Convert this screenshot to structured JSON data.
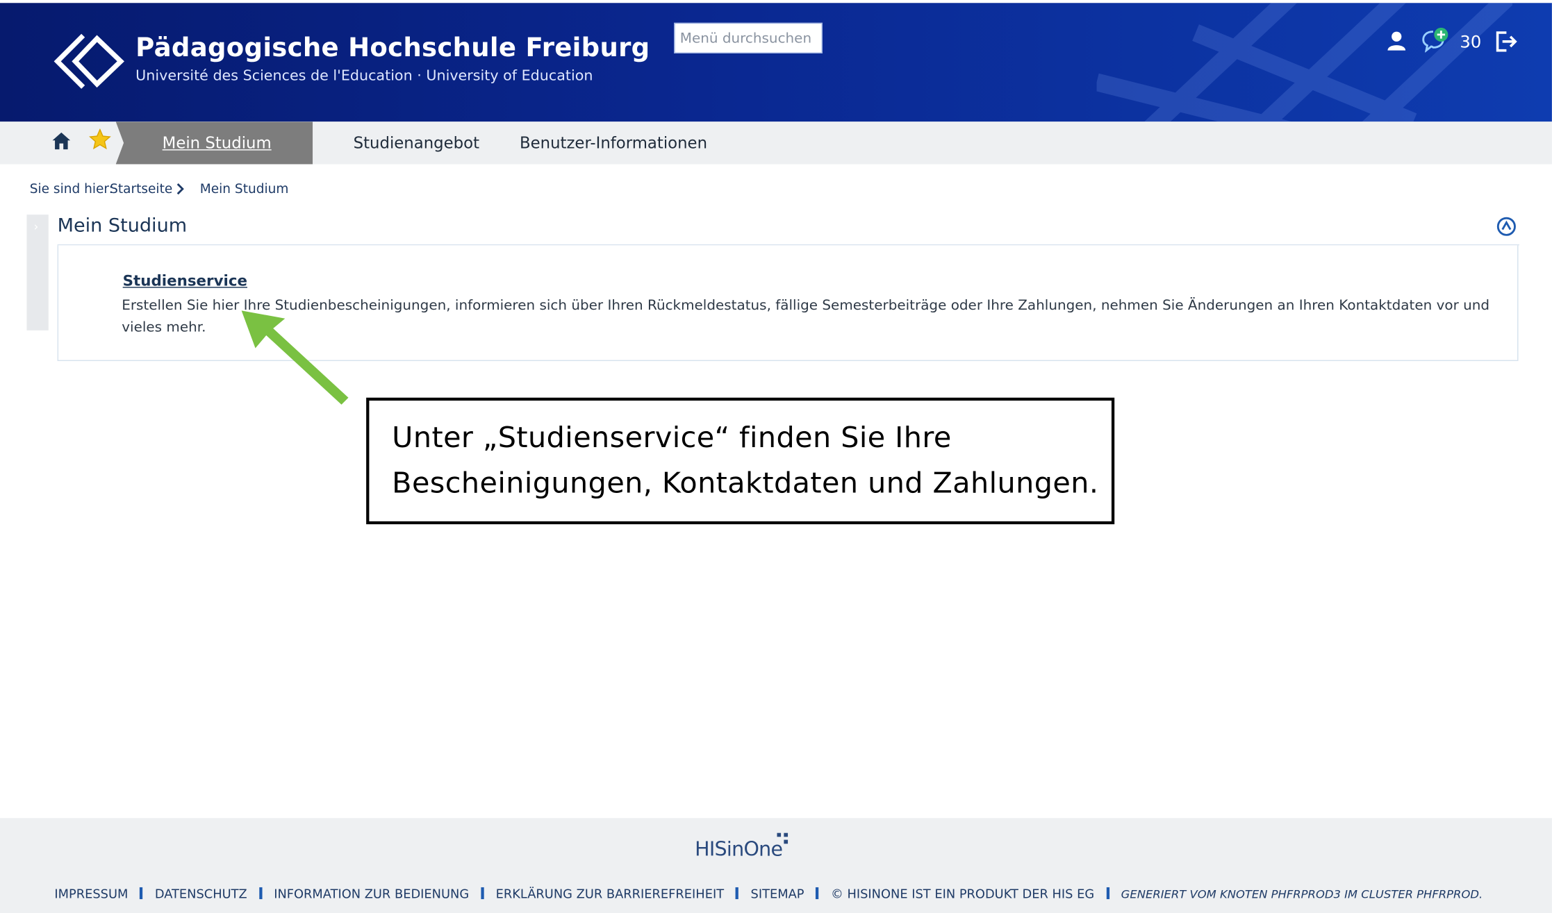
{
  "header": {
    "title": "Pädagogische Hochschule Freiburg",
    "subtitle": "Université des Sciences de l'Education · University of Education",
    "search_placeholder": "Menü durchsuchen",
    "session_counter": "30",
    "icons": [
      "user-icon",
      "chat-add-icon",
      "logout-icon"
    ]
  },
  "nav": {
    "icons": [
      "home-icon",
      "star-icon"
    ],
    "tabs": [
      {
        "label": "Mein Studium",
        "active": true
      },
      {
        "label": "Studienangebot",
        "active": false
      },
      {
        "label": "Benutzer-Informationen",
        "active": false
      }
    ]
  },
  "breadcrumb": {
    "label": "Sie sind hier:",
    "items": [
      "Startseite",
      "Mein Studium"
    ]
  },
  "section": {
    "title": "Mein Studium",
    "link": "Studienservice",
    "description": "Erstellen Sie hier Ihre Studienbescheinigungen, informieren sich über Ihren Rückmeldestatus, fällige Semesterbeiträge oder Ihre Zahlungen, nehmen Sie Änderungen an Ihren Kontaktdaten vor und vieles mehr."
  },
  "annotation": {
    "text": "Unter „Studienservice“ finden Sie Ihre Bescheinigungen, Kontaktdaten und Zahlungen.",
    "arrow_color": "#7ac142"
  },
  "footer": {
    "logo": "HISinOne",
    "links": [
      "IMPRESSUM",
      "DATENSCHUTZ",
      "INFORMATION ZUR BEDIENUNG",
      "ERKLÄRUNG ZUR BARRIEREFREIHEIT",
      "SITEMAP",
      "© HISINONE IST EIN PRODUKT DER HIS EG"
    ],
    "generated": "GENERIERT VOM KNOTEN PHFRPROD3 IM CLUSTER PHFRPROD."
  },
  "colors": {
    "header_dark": "#061a6e",
    "header_light": "#0e3cb0",
    "nav_active": "#7d7d7d",
    "link": "#1b3556",
    "accent_blue": "#1e5bb0"
  }
}
